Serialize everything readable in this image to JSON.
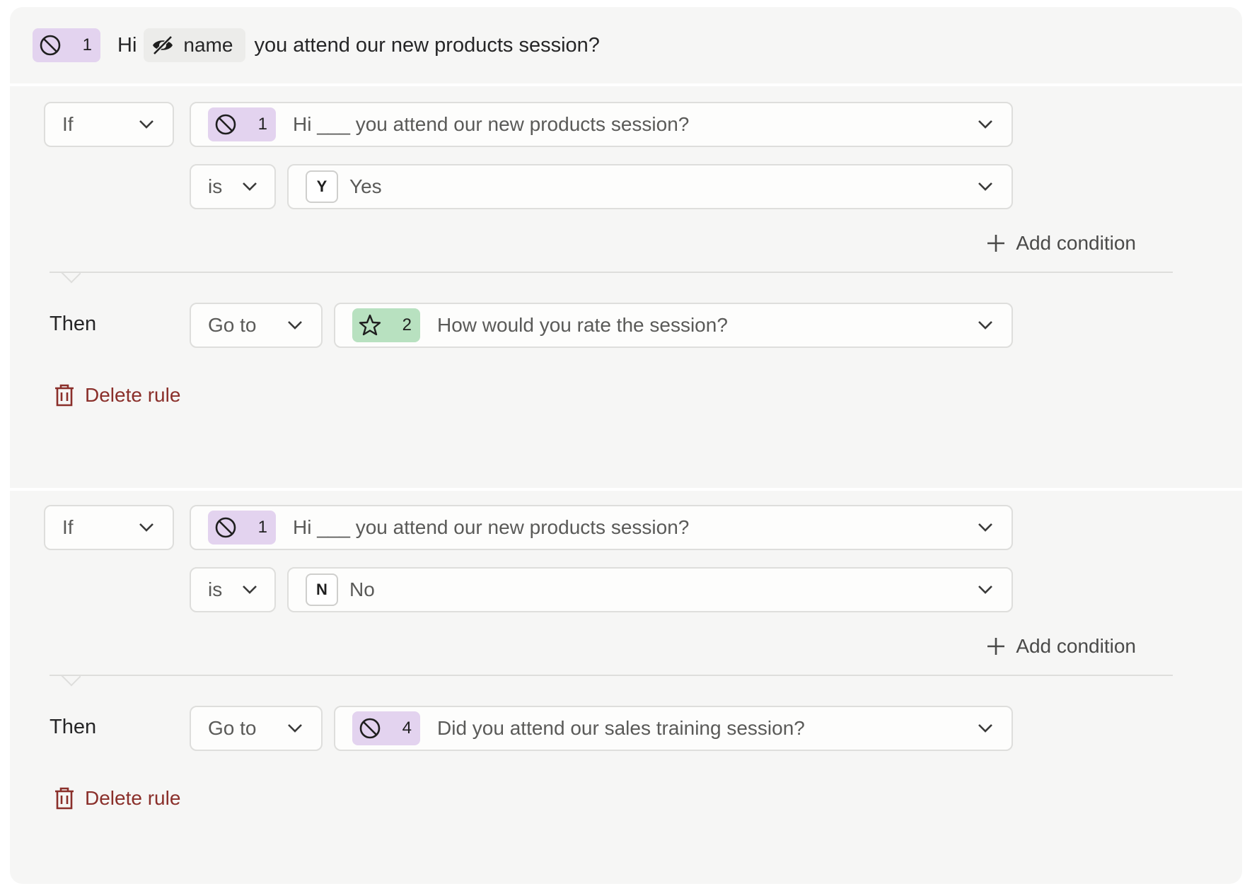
{
  "header": {
    "badge_number": "1",
    "hi_text": "Hi",
    "variable_label": "name",
    "rest_text": "you attend our new products session?"
  },
  "rules": [
    {
      "if_label": "If",
      "question_badge": "1",
      "question_text": "Hi ___ you attend our new products session?",
      "operator_label": "is",
      "answer_key": "Y",
      "answer_text": "Yes",
      "add_condition_label": "Add condition",
      "then_label": "Then",
      "action_label": "Go to",
      "target_badge": "2",
      "target_icon": "star-icon",
      "target_text": "How would you rate the session?",
      "delete_label": "Delete rule"
    },
    {
      "if_label": "If",
      "question_badge": "1",
      "question_text": "Hi ___ you attend our new products session?",
      "operator_label": "is",
      "answer_key": "N",
      "answer_text": "No",
      "add_condition_label": "Add condition",
      "then_label": "Then",
      "action_label": "Go to",
      "target_badge": "4",
      "target_icon": "yes-no-icon",
      "target_text": "Did you attend our sales training session?",
      "delete_label": "Delete rule"
    }
  ],
  "colors": {
    "panel_bg": "#f6f6f5",
    "badge_purple": "#e3d3ef",
    "badge_green": "#b8e1c0",
    "delete_red": "#8a2f2a"
  }
}
